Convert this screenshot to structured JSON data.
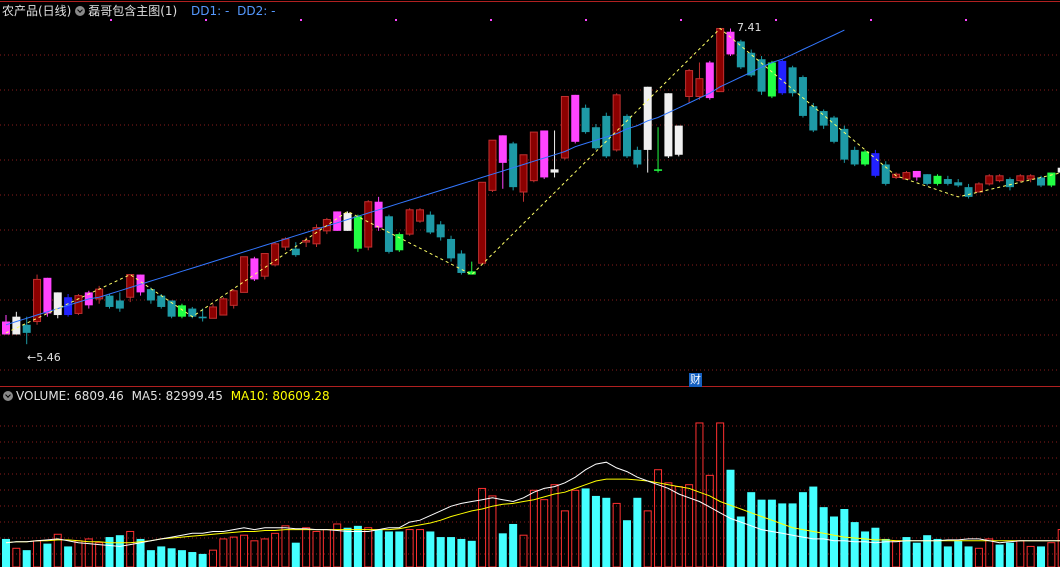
{
  "header": {
    "symbol": "农产品(日线)",
    "indicator": "磊哥包含主图(1)",
    "dd1_label": "DD1: -",
    "dd2_label": "DD2: -"
  },
  "volume_header": {
    "volume_label": "VOLUME: 6809.46",
    "ma5_label": "MA5: 82999.45",
    "ma10_label": "MA10: 80609.28"
  },
  "annotations": {
    "low_price": "←5.46",
    "high_price": "7.41",
    "finance_marker": "财"
  },
  "colors": {
    "background": "#000000",
    "up": "#c03030",
    "up_fill_dark": "#8b0000",
    "down": "#1e9aa6",
    "magenta": "#ff44ff",
    "green": "#22ff44",
    "blue": "#2222ff",
    "white": "#f0f0f0",
    "volume_up": "#ff3030",
    "volume_down": "#44ffff",
    "ma_blue": "#3377ff",
    "zigzag": "#ffff66",
    "ma5": "#ffffff",
    "ma10": "#ffff00",
    "grid": "#8a1c1c",
    "dd_label": "#5599ff"
  },
  "chart_data": {
    "type": "candlestick",
    "price_range": [
      5.35,
      7.45
    ],
    "candles": [
      {
        "o": 5.6,
        "h": 5.64,
        "l": 5.52,
        "c": 5.52,
        "k": "m"
      },
      {
        "o": 5.52,
        "h": 5.66,
        "l": 5.52,
        "c": 5.63,
        "k": "w"
      },
      {
        "o": 5.58,
        "h": 5.63,
        "l": 5.46,
        "c": 5.53,
        "k": "t"
      },
      {
        "o": 5.6,
        "h": 5.89,
        "l": 5.58,
        "c": 5.86,
        "k": "r"
      },
      {
        "o": 5.87,
        "h": 5.87,
        "l": 5.63,
        "c": 5.65,
        "k": "m"
      },
      {
        "o": 5.64,
        "h": 5.78,
        "l": 5.62,
        "c": 5.78,
        "k": "w"
      },
      {
        "o": 5.75,
        "h": 5.77,
        "l": 5.63,
        "c": 5.64,
        "k": "b"
      },
      {
        "o": 5.65,
        "h": 5.77,
        "l": 5.64,
        "c": 5.76,
        "k": "r"
      },
      {
        "o": 5.7,
        "h": 5.79,
        "l": 5.68,
        "c": 5.78,
        "k": "m"
      },
      {
        "o": 5.74,
        "h": 5.82,
        "l": 5.71,
        "c": 5.8,
        "k": "r"
      },
      {
        "o": 5.76,
        "h": 5.77,
        "l": 5.68,
        "c": 5.69,
        "k": "t"
      },
      {
        "o": 5.73,
        "h": 5.78,
        "l": 5.66,
        "c": 5.68,
        "k": "t"
      },
      {
        "o": 5.75,
        "h": 5.89,
        "l": 5.72,
        "c": 5.89,
        "k": "r"
      },
      {
        "o": 5.89,
        "h": 5.89,
        "l": 5.76,
        "c": 5.78,
        "k": "m"
      },
      {
        "o": 5.8,
        "h": 5.81,
        "l": 5.71,
        "c": 5.73,
        "k": "t"
      },
      {
        "o": 5.76,
        "h": 5.77,
        "l": 5.68,
        "c": 5.69,
        "k": "t"
      },
      {
        "o": 5.73,
        "h": 5.73,
        "l": 5.62,
        "c": 5.63,
        "k": "t"
      },
      {
        "o": 5.7,
        "h": 5.71,
        "l": 5.62,
        "c": 5.63,
        "k": "g"
      },
      {
        "o": 5.68,
        "h": 5.69,
        "l": 5.62,
        "c": 5.63,
        "k": "t"
      },
      {
        "o": 5.63,
        "h": 5.68,
        "l": 5.6,
        "c": 5.62,
        "k": "t"
      },
      {
        "o": 5.62,
        "h": 5.71,
        "l": 5.62,
        "c": 5.69,
        "k": "r"
      },
      {
        "o": 5.64,
        "h": 5.75,
        "l": 5.64,
        "c": 5.74,
        "k": "r"
      },
      {
        "o": 5.7,
        "h": 5.8,
        "l": 5.68,
        "c": 5.79,
        "k": "r"
      },
      {
        "o": 5.78,
        "h": 6.0,
        "l": 5.78,
        "c": 6.0,
        "k": "r"
      },
      {
        "o": 5.86,
        "h": 6.0,
        "l": 5.85,
        "c": 5.99,
        "k": "m"
      },
      {
        "o": 5.88,
        "h": 6.02,
        "l": 5.86,
        "c": 6.02,
        "k": "r"
      },
      {
        "o": 5.95,
        "h": 6.09,
        "l": 5.94,
        "c": 6.08,
        "k": "r"
      },
      {
        "o": 6.06,
        "h": 6.12,
        "l": 6.04,
        "c": 6.11,
        "k": "r"
      },
      {
        "o": 6.05,
        "h": 6.09,
        "l": 6.0,
        "c": 6.01,
        "k": "t"
      },
      {
        "o": 6.1,
        "h": 6.12,
        "l": 6.06,
        "c": 6.1,
        "k": "r"
      },
      {
        "o": 6.08,
        "h": 6.2,
        "l": 6.06,
        "c": 6.18,
        "k": "r"
      },
      {
        "o": 6.16,
        "h": 6.24,
        "l": 6.14,
        "c": 6.23,
        "k": "r"
      },
      {
        "o": 6.16,
        "h": 6.28,
        "l": 6.16,
        "c": 6.28,
        "k": "m"
      },
      {
        "o": 6.27,
        "h": 6.28,
        "l": 6.16,
        "c": 6.16,
        "k": "w"
      },
      {
        "o": 6.25,
        "h": 6.26,
        "l": 6.03,
        "c": 6.05,
        "k": "g"
      },
      {
        "o": 6.06,
        "h": 6.35,
        "l": 6.04,
        "c": 6.34,
        "k": "r"
      },
      {
        "o": 6.34,
        "h": 6.37,
        "l": 6.16,
        "c": 6.18,
        "k": "m"
      },
      {
        "o": 6.25,
        "h": 6.26,
        "l": 6.02,
        "c": 6.03,
        "k": "t"
      },
      {
        "o": 6.14,
        "h": 6.15,
        "l": 6.03,
        "c": 6.04,
        "k": "g"
      },
      {
        "o": 6.14,
        "h": 6.3,
        "l": 6.13,
        "c": 6.29,
        "k": "r"
      },
      {
        "o": 6.22,
        "h": 6.3,
        "l": 6.21,
        "c": 6.29,
        "k": "r"
      },
      {
        "o": 6.26,
        "h": 6.28,
        "l": 6.14,
        "c": 6.15,
        "k": "t"
      },
      {
        "o": 6.2,
        "h": 6.22,
        "l": 6.1,
        "c": 6.12,
        "k": "t"
      },
      {
        "o": 6.11,
        "h": 6.13,
        "l": 5.97,
        "c": 5.99,
        "k": "t"
      },
      {
        "o": 6.02,
        "h": 6.04,
        "l": 5.89,
        "c": 5.9,
        "k": "t"
      },
      {
        "o": 5.91,
        "h": 5.97,
        "l": 5.89,
        "c": 5.89,
        "k": "g"
      },
      {
        "o": 5.96,
        "h": 6.46,
        "l": 5.96,
        "c": 6.46,
        "k": "r"
      },
      {
        "o": 6.41,
        "h": 6.72,
        "l": 6.4,
        "c": 6.72,
        "k": "r"
      },
      {
        "o": 6.75,
        "h": 6.75,
        "l": 6.42,
        "c": 6.58,
        "k": "m"
      },
      {
        "o": 6.7,
        "h": 6.71,
        "l": 6.41,
        "c": 6.43,
        "k": "t"
      },
      {
        "o": 6.4,
        "h": 6.63,
        "l": 6.34,
        "c": 6.63,
        "k": "r"
      },
      {
        "o": 6.47,
        "h": 6.77,
        "l": 6.46,
        "c": 6.77,
        "k": "r"
      },
      {
        "o": 6.49,
        "h": 6.78,
        "l": 6.48,
        "c": 6.78,
        "k": "m"
      },
      {
        "o": 6.52,
        "h": 6.78,
        "l": 6.49,
        "c": 6.54,
        "k": "w"
      },
      {
        "o": 6.61,
        "h": 6.99,
        "l": 6.6,
        "c": 6.99,
        "k": "r"
      },
      {
        "o": 6.71,
        "h": 7.0,
        "l": 6.7,
        "c": 7.0,
        "k": "m"
      },
      {
        "o": 6.92,
        "h": 6.94,
        "l": 6.76,
        "c": 6.77,
        "k": "t"
      },
      {
        "o": 6.8,
        "h": 6.82,
        "l": 6.66,
        "c": 6.67,
        "k": "t"
      },
      {
        "o": 6.87,
        "h": 6.89,
        "l": 6.61,
        "c": 6.62,
        "k": "t"
      },
      {
        "o": 6.66,
        "h": 7.01,
        "l": 6.65,
        "c": 7.0,
        "k": "r"
      },
      {
        "o": 6.87,
        "h": 6.88,
        "l": 6.61,
        "c": 6.62,
        "k": "t"
      },
      {
        "o": 6.66,
        "h": 6.68,
        "l": 6.55,
        "c": 6.57,
        "k": "t"
      },
      {
        "o": 6.66,
        "h": 7.05,
        "l": 6.52,
        "c": 7.05,
        "k": "w"
      },
      {
        "o": 6.54,
        "h": 6.8,
        "l": 6.52,
        "c": 6.54,
        "k": "g"
      },
      {
        "o": 6.62,
        "h": 7.01,
        "l": 6.61,
        "c": 7.01,
        "k": "w"
      },
      {
        "o": 6.63,
        "h": 6.81,
        "l": 6.62,
        "c": 6.81,
        "k": "w"
      },
      {
        "o": 6.99,
        "h": 7.16,
        "l": 6.95,
        "c": 7.15,
        "k": "r"
      },
      {
        "o": 6.99,
        "h": 7.2,
        "l": 6.97,
        "c": 7.1,
        "k": "r"
      },
      {
        "o": 6.98,
        "h": 7.21,
        "l": 6.97,
        "c": 7.2,
        "k": "m"
      },
      {
        "o": 7.02,
        "h": 7.41,
        "l": 7.02,
        "c": 7.41,
        "k": "r"
      },
      {
        "o": 7.39,
        "h": 7.41,
        "l": 7.24,
        "c": 7.25,
        "k": "m"
      },
      {
        "o": 7.33,
        "h": 7.34,
        "l": 7.16,
        "c": 7.17,
        "k": "t"
      },
      {
        "o": 7.26,
        "h": 7.28,
        "l": 7.11,
        "c": 7.12,
        "k": "t"
      },
      {
        "o": 7.22,
        "h": 7.24,
        "l": 7.0,
        "c": 7.02,
        "k": "t"
      },
      {
        "o": 7.2,
        "h": 7.21,
        "l": 6.98,
        "c": 6.99,
        "k": "g"
      },
      {
        "o": 7.21,
        "h": 7.22,
        "l": 7.0,
        "c": 7.01,
        "k": "b"
      },
      {
        "o": 7.17,
        "h": 7.18,
        "l": 6.99,
        "c": 7.01,
        "k": "t"
      },
      {
        "o": 7.11,
        "h": 7.12,
        "l": 6.86,
        "c": 6.87,
        "k": "t"
      },
      {
        "o": 6.93,
        "h": 6.95,
        "l": 6.77,
        "c": 6.78,
        "k": "t"
      },
      {
        "o": 6.9,
        "h": 6.91,
        "l": 6.79,
        "c": 6.81,
        "k": "t"
      },
      {
        "o": 6.86,
        "h": 6.87,
        "l": 6.7,
        "c": 6.71,
        "k": "t"
      },
      {
        "o": 6.79,
        "h": 6.81,
        "l": 6.58,
        "c": 6.6,
        "k": "t"
      },
      {
        "o": 6.66,
        "h": 6.68,
        "l": 6.56,
        "c": 6.57,
        "k": "t"
      },
      {
        "o": 6.65,
        "h": 6.66,
        "l": 6.56,
        "c": 6.57,
        "k": "g"
      },
      {
        "o": 6.64,
        "h": 6.66,
        "l": 6.49,
        "c": 6.5,
        "k": "b"
      },
      {
        "o": 6.57,
        "h": 6.59,
        "l": 6.44,
        "c": 6.45,
        "k": "t"
      },
      {
        "o": 6.49,
        "h": 6.52,
        "l": 6.48,
        "c": 6.51,
        "k": "r"
      },
      {
        "o": 6.52,
        "h": 6.53,
        "l": 6.48,
        "c": 6.48,
        "k": "r"
      },
      {
        "o": 6.53,
        "h": 6.53,
        "l": 6.47,
        "c": 6.49,
        "k": "m"
      },
      {
        "o": 6.51,
        "h": 6.51,
        "l": 6.44,
        "c": 6.45,
        "k": "t"
      },
      {
        "o": 6.5,
        "h": 6.51,
        "l": 6.44,
        "c": 6.45,
        "k": "g"
      },
      {
        "o": 6.48,
        "h": 6.5,
        "l": 6.44,
        "c": 6.45,
        "k": "t"
      },
      {
        "o": 6.46,
        "h": 6.48,
        "l": 6.43,
        "c": 6.44,
        "k": "t"
      },
      {
        "o": 6.43,
        "h": 6.45,
        "l": 6.36,
        "c": 6.37,
        "k": "t"
      },
      {
        "o": 6.4,
        "h": 6.46,
        "l": 6.4,
        "c": 6.45,
        "k": "r"
      },
      {
        "o": 6.45,
        "h": 6.51,
        "l": 6.44,
        "c": 6.5,
        "k": "r"
      },
      {
        "o": 6.5,
        "h": 6.51,
        "l": 6.46,
        "c": 6.47,
        "k": "r"
      },
      {
        "o": 6.48,
        "h": 6.49,
        "l": 6.41,
        "c": 6.43,
        "k": "t"
      },
      {
        "o": 6.47,
        "h": 6.51,
        "l": 6.46,
        "c": 6.5,
        "k": "r"
      },
      {
        "o": 6.48,
        "h": 6.51,
        "l": 6.46,
        "c": 6.5,
        "k": "r"
      },
      {
        "o": 6.49,
        "h": 6.5,
        "l": 6.43,
        "c": 6.44,
        "k": "t"
      },
      {
        "o": 6.44,
        "h": 6.52,
        "l": 6.43,
        "c": 6.52,
        "k": "g"
      },
      {
        "o": 6.52,
        "h": 6.55,
        "l": 6.5,
        "c": 6.55,
        "k": "w"
      },
      {
        "o": 6.5,
        "h": 6.55,
        "l": 6.5,
        "c": 6.55,
        "k": "w"
      },
      {
        "o": 6.51,
        "h": 6.55,
        "l": 6.5,
        "c": 6.55,
        "k": "m"
      }
    ],
    "ma_line": [
      5.58,
      5.6,
      5.62,
      5.64,
      5.66,
      5.68,
      5.7,
      5.72,
      5.74,
      5.75,
      5.77,
      5.79,
      5.81,
      5.83,
      5.85,
      5.87,
      5.89,
      5.91,
      5.93,
      5.95,
      5.97,
      5.99,
      6.01,
      6.03,
      6.05,
      6.07,
      6.09,
      6.11,
      6.13,
      6.15,
      6.17,
      6.19,
      6.21,
      6.23,
      6.25,
      6.27,
      6.29,
      6.31,
      6.33,
      6.35,
      6.37,
      6.39,
      6.41,
      6.43,
      6.45,
      6.47,
      6.49,
      6.51,
      6.53,
      6.55,
      6.57,
      6.59,
      6.61,
      6.63,
      6.65,
      6.68,
      6.7,
      6.72,
      6.74,
      6.76,
      6.79,
      6.81,
      6.84,
      6.86,
      6.89,
      6.92,
      6.95,
      6.98,
      7.01,
      7.05,
      7.08,
      7.11,
      7.14,
      7.17,
      7.2,
      7.22,
      7.25,
      7.28,
      7.31,
      7.34,
      7.37,
      7.4
    ],
    "zigzag": [
      [
        0,
        5.53
      ],
      [
        12,
        5.89
      ],
      [
        18,
        5.63
      ],
      [
        33,
        6.28
      ],
      [
        45,
        5.89
      ],
      [
        69,
        7.41
      ],
      [
        86,
        6.5
      ],
      [
        92,
        6.37
      ],
      [
        104,
        6.55
      ]
    ],
    "volume": {
      "ylim": [
        0,
        170000
      ],
      "values": [
        30000,
        20000,
        18000,
        28000,
        25000,
        35000,
        22000,
        28000,
        30000,
        26000,
        32000,
        34000,
        38000,
        30000,
        18000,
        22000,
        20000,
        18000,
        16000,
        14000,
        18000,
        30000,
        32000,
        34000,
        28000,
        30000,
        36000,
        44000,
        26000,
        42000,
        38000,
        40000,
        46000,
        42000,
        44000,
        42000,
        40000,
        38000,
        38000,
        40000,
        40000,
        38000,
        32000,
        32000,
        30000,
        28000,
        84000,
        76000,
        36000,
        46000,
        34000,
        82000,
        72000,
        88000,
        60000,
        82000,
        84000,
        76000,
        74000,
        68000,
        50000,
        74000,
        60000,
        104000,
        90000,
        86000,
        88000,
        154000,
        98000,
        154000,
        104000,
        54000,
        80000,
        72000,
        72000,
        68000,
        68000,
        80000,
        86000,
        64000,
        54000,
        62000,
        48000,
        38000,
        42000,
        30000,
        28000,
        32000,
        26000,
        34000,
        30000,
        22000,
        28000,
        22000,
        20000,
        30000,
        24000,
        26000,
        28000,
        22000,
        22000,
        26000,
        40000,
        36000,
        22000
      ],
      "ma5": [
        26000,
        27000,
        27000,
        28000,
        29000,
        30000,
        28000,
        26000,
        25000,
        24000,
        23000,
        22000,
        24000,
        26000,
        28000,
        30000,
        32000,
        34000,
        36000,
        36000,
        38000,
        38000,
        40000,
        42000,
        40000,
        42000,
        42000,
        42000,
        41000,
        41000,
        40000,
        40000,
        39000,
        38000,
        38000,
        38000,
        40000,
        42000,
        42000,
        48000,
        50000,
        55000,
        60000,
        65000,
        68000,
        70000,
        72000,
        74000,
        72000,
        70000,
        74000,
        80000,
        84000,
        86000,
        90000,
        96000,
        104000,
        110000,
        112000,
        106000,
        102000,
        96000,
        92000,
        88000,
        84000,
        78000,
        74000,
        70000,
        64000,
        58000,
        52000,
        48000,
        44000,
        40000,
        38000,
        36000,
        34000,
        32000,
        30000,
        30000,
        28000,
        28000,
        27000,
        27000,
        26000,
        27000,
        27000,
        28000,
        28000,
        28000,
        28000,
        29000,
        29000,
        30000,
        30000,
        28000,
        26000,
        27000,
        28000,
        28000,
        28000,
        28000,
        28000,
        28000,
        28000
      ],
      "ma10": [
        26000,
        27000,
        27000,
        28000,
        28000,
        29000,
        29000,
        28000,
        27000,
        27000,
        26000,
        26000,
        26000,
        27000,
        28000,
        30000,
        31000,
        32000,
        33000,
        34000,
        35000,
        36000,
        37000,
        38000,
        38000,
        39000,
        39000,
        40000,
        40000,
        40000,
        40000,
        40000,
        40000,
        40000,
        40000,
        40000,
        40000,
        40000,
        41000,
        43000,
        45000,
        47000,
        50000,
        54000,
        57000,
        60000,
        62000,
        65000,
        67000,
        68000,
        70000,
        72000,
        75000,
        78000,
        80000,
        84000,
        88000,
        92000,
        94000,
        94000,
        94000,
        93000,
        92000,
        90000,
        88000,
        86000,
        84000,
        80000,
        76000,
        70000,
        66000,
        62000,
        58000,
        54000,
        50000,
        46000,
        42000,
        40000,
        38000,
        36000,
        34000,
        32000,
        31000,
        30000,
        29000,
        29000,
        28000,
        28000,
        28000,
        28000,
        28000,
        28000,
        28000,
        28000,
        28000,
        28000,
        28000,
        28000,
        28000,
        28000,
        28000,
        28000,
        28000,
        28000,
        28000
      ]
    }
  }
}
